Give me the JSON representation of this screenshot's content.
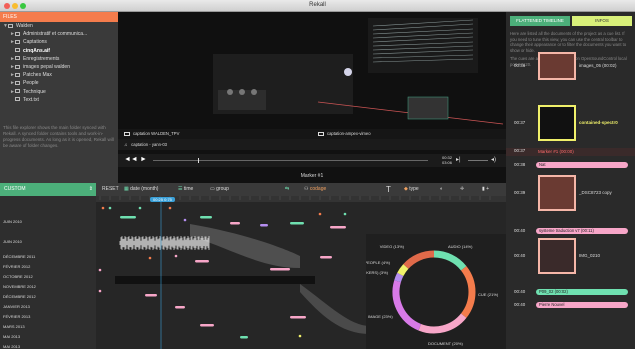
{
  "app": {
    "title": "Rekall"
  },
  "files": {
    "header": "FILES",
    "items": [
      {
        "label": "Walden",
        "indent": 0,
        "arrow": "▼",
        "active": false
      },
      {
        "label": "Administratif et communica...",
        "indent": 1,
        "arrow": "►",
        "active": false
      },
      {
        "label": "Captations",
        "indent": 1,
        "arrow": "►",
        "active": false
      },
      {
        "label": "cinqAns.aif",
        "indent": 1,
        "arrow": "",
        "active": true
      },
      {
        "label": "Enregistrements",
        "indent": 1,
        "arrow": "►",
        "active": false
      },
      {
        "label": "images pepal walden",
        "indent": 1,
        "arrow": "►",
        "active": false
      },
      {
        "label": "Patches Max",
        "indent": 1,
        "arrow": "►",
        "active": false
      },
      {
        "label": "People",
        "indent": 1,
        "arrow": "►",
        "active": false
      },
      {
        "label": "Technique",
        "indent": 1,
        "arrow": "►",
        "active": false
      },
      {
        "label": "Text.txt",
        "indent": 1,
        "arrow": "",
        "active": false
      }
    ],
    "note": "This file explorer shows the main folder synced with Rekall. A synced folder contains tools and work-in-progress documents. As long as it is opened, Rekall will be aware of folder changes."
  },
  "player": {
    "video_items": [
      "captation WALDEN_TPV",
      "captation-ampex-vimeo"
    ],
    "audio_item": "captation - yann-03",
    "time_current": "00:32",
    "time_total": "03:06",
    "marker_label": "Marker #1"
  },
  "right_panel": {
    "tab_active": "FLATTENED TIMELINE",
    "tab_other": "INFOS",
    "description": "Here are listed all the documents of the project as a cue list. If you need to tune this view, you can use the central toolbar to change their appearance or to filter the documents you want to show or hide.",
    "description2": "The cues are also sent in real time on OpenSoundControl local port 57120.",
    "entries": [
      {
        "time": "00:36",
        "label": "images_05 (00:02)",
        "kind": "thumb",
        "label_color": "#dddddd"
      },
      {
        "time": "00:37",
        "label": "contained-spectr0",
        "kind": "thumb",
        "label_color": "#f0f06a"
      },
      {
        "time": "00:37",
        "label": "Marker #1 (00:00)",
        "kind": "marker",
        "label_color": "#ff6a6a"
      },
      {
        "time": "00:38",
        "label": "Nat",
        "kind": "pill",
        "label_color": "#f7a6c8"
      },
      {
        "time": "00:39",
        "label": "_DSC8723 copy",
        "kind": "thumb",
        "label_color": "#dddddd"
      },
      {
        "time": "00:40",
        "label": "systeme traduction v7 (00:11)",
        "kind": "pill",
        "label_color": "#f7a6c8"
      },
      {
        "time": "00:40",
        "label": "IMG_0210",
        "kind": "thumb",
        "label_color": "#dddddd"
      },
      {
        "time": "00:40",
        "label": "P09_02 (00:02)",
        "kind": "pill",
        "label_color": "#6fe0b0"
      },
      {
        "time": "00:40",
        "label": "Pierre Nouvel",
        "kind": "pill",
        "label_color": "#f7a6c8"
      }
    ]
  },
  "toolbar": {
    "filter": "CUSTOM",
    "reset": "RESET",
    "date": "date (month)",
    "time": "time",
    "group": "group",
    "codage": "codage",
    "type": "type",
    "plus": "+"
  },
  "timeline": {
    "ruler_label": "00:25 0:75",
    "dates": [
      "JUIN 2010",
      "JUIN 2010",
      "DÉCEMBRE 2011",
      "FÉVRIER 2012",
      "OCTOBRE 2012",
      "NOVEMBRE 2012",
      "DÉCEMBRE 2012",
      "JANVIER 2013",
      "FÉVRIER 2013",
      "MARS 2013",
      "MAI 2013",
      "MAI 2013"
    ]
  },
  "donut": {
    "labels": [
      {
        "text": "VIDEO (13%)",
        "color": "#f47c4c"
      },
      {
        "text": "AUDIO (14%)",
        "color": "#6fe0b0"
      },
      {
        "text": "PEOPLE (4%)",
        "color": "#f0f06a"
      },
      {
        "text": "OTHER (MARKERS) (3%)",
        "color": "#b58ef0"
      },
      {
        "text": "CUE (21%)",
        "color": "#f47c4c"
      },
      {
        "text": "IMAGE (23%)",
        "color": "#d87ae8"
      },
      {
        "text": "DOCUMENT (20%)",
        "color": "#f7a6c8"
      }
    ],
    "slices": [
      {
        "value": 14,
        "color": "#6fe0b0"
      },
      {
        "value": 21,
        "color": "#f47c4c"
      },
      {
        "value": 20,
        "color": "#f7a6c8"
      },
      {
        "value": 23,
        "color": "#d87ae8"
      },
      {
        "value": 3,
        "color": "#b58ef0"
      },
      {
        "value": 4,
        "color": "#f0f06a"
      },
      {
        "value": 13,
        "color": "#e06a4a"
      }
    ]
  }
}
